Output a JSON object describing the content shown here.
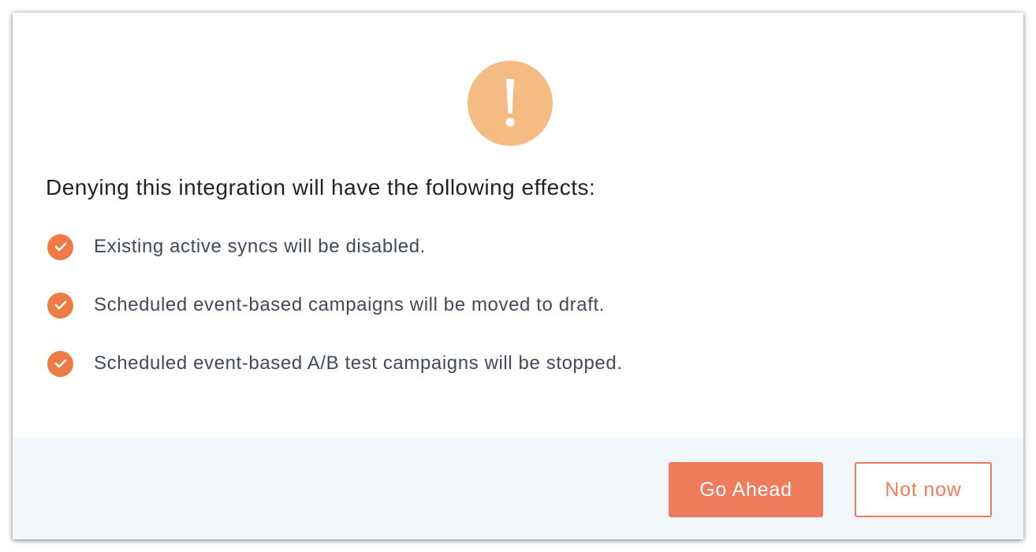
{
  "dialog": {
    "icon": "warning-exclamation-icon",
    "heading": "Denying this integration will have the following effects:",
    "effects": [
      "Existing active syncs will be disabled.",
      "Scheduled event-based campaigns will be moved to draft.",
      "Scheduled event-based A/B test campaigns will be stopped."
    ],
    "effect_icon": "check-circle-icon"
  },
  "footer": {
    "primary_label": "Go Ahead",
    "secondary_label": "Not now"
  },
  "colors": {
    "warning_bg": "#f4bc83",
    "accent": "#ee7b5c",
    "check_bg": "#ee7b43",
    "footer_bg": "#f1f7fb"
  }
}
